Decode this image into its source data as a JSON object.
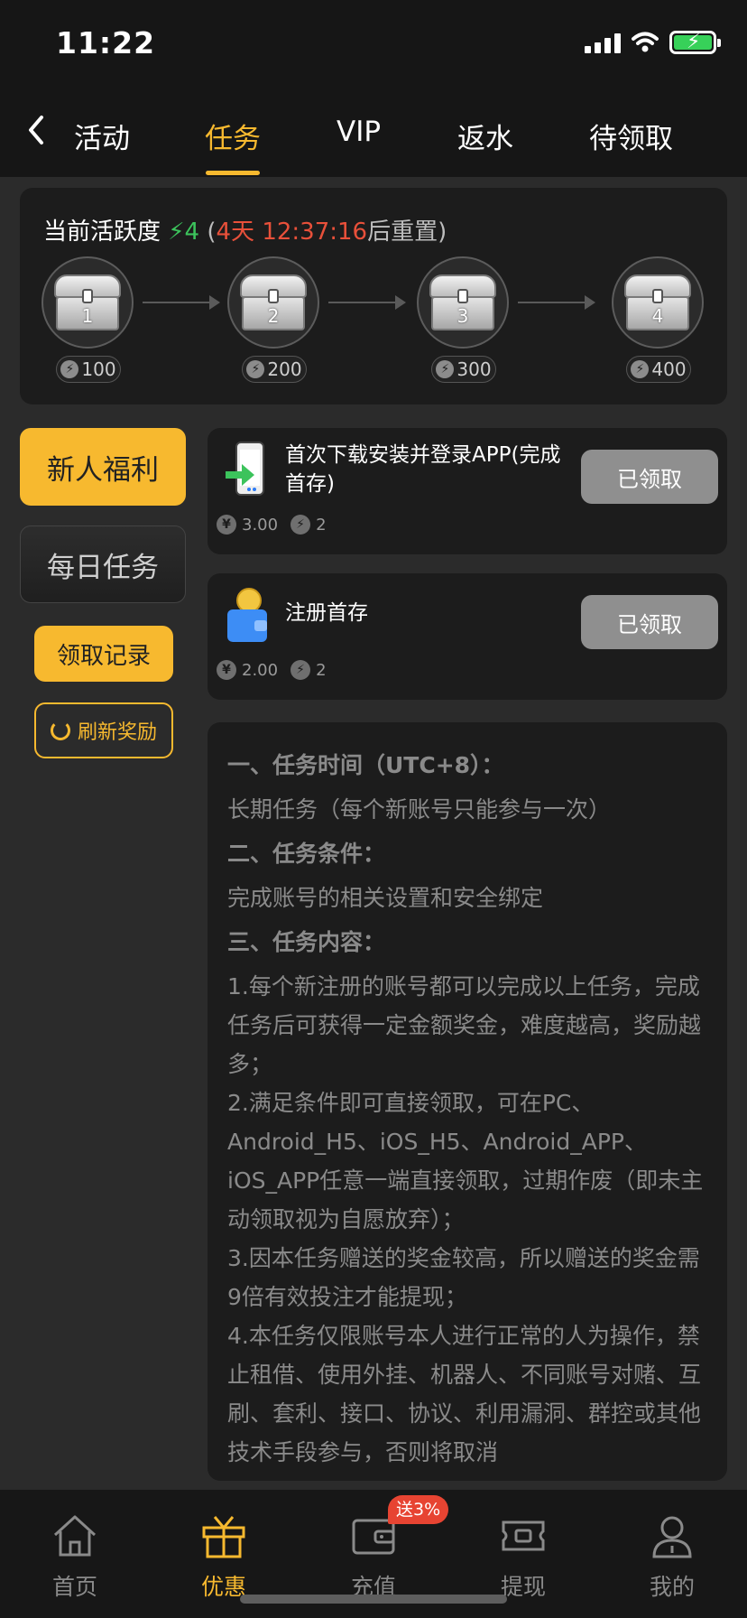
{
  "status_bar": {
    "time": "11:22"
  },
  "nav": {
    "tabs": [
      {
        "label": "活动",
        "active": false
      },
      {
        "label": "任务",
        "active": true
      },
      {
        "label": "VIP",
        "active": false
      },
      {
        "label": "返水",
        "active": false
      },
      {
        "label": "待领取",
        "active": false
      }
    ]
  },
  "activity": {
    "label": "当前活跃度",
    "value": "4",
    "reset_open": "(",
    "reset_days": "4天",
    "reset_time": "12:37:16",
    "reset_suffix": "后重置)",
    "chests": [
      {
        "num": "1",
        "points": "100"
      },
      {
        "num": "2",
        "points": "200"
      },
      {
        "num": "3",
        "points": "300"
      },
      {
        "num": "4",
        "points": "400"
      }
    ]
  },
  "sidebar": {
    "new_user": "新人福利",
    "daily": "每日任务",
    "record": "领取记录",
    "refresh": "刷新奖励"
  },
  "tasks": [
    {
      "title": "首次下载安装并登录APP(完成首存)",
      "button": "已领取",
      "reward": "3.00",
      "activity": "2",
      "icon": "phone-download-icon"
    },
    {
      "title": "注册首存",
      "button": "已领取",
      "reward": "2.00",
      "activity": "2",
      "icon": "wallet-coin-icon"
    }
  ],
  "rules": {
    "h1": "一、任务时间（UTC+8）：",
    "p1": "长期任务（每个新账号只能参与一次）",
    "h2": "二、任务条件：",
    "p2": "完成账号的相关设置和安全绑定",
    "h3": "三、任务内容：",
    "p3": "1.每个新注册的账号都可以完成以上任务，完成任务后可获得一定金额奖金，难度越高，奖励越多；",
    "p4": "2.满足条件即可直接领取，可在PC、Android_H5、iOS_H5、Android_APP、iOS_APP任意一端直接领取，过期作废（即未主动领取视为自愿放弃）；",
    "p5": "3.因本任务赠送的奖金较高，所以赠送的奖金需9倍有效投注才能提现；",
    "p6": "4.本任务仅限账号本人进行正常的人为操作，禁止租借、使用外挂、机器人、不同账号对赌、互刷、套利、接口、协议、利用漏洞、群控或其他技术手段参与，否则将取消"
  },
  "tabbar": {
    "items": [
      {
        "label": "首页",
        "icon": "home-icon",
        "active": false
      },
      {
        "label": "优惠",
        "icon": "gift-icon",
        "active": true
      },
      {
        "label": "充值",
        "icon": "wallet-icon",
        "active": false
      },
      {
        "label": "提现",
        "icon": "ticket-icon",
        "active": false
      },
      {
        "label": "我的",
        "icon": "profile-icon",
        "active": false
      }
    ],
    "deposit_badge": "送3%"
  },
  "colors": {
    "accent": "#f7b92f",
    "green": "#3cc35c",
    "red": "#e8503a",
    "panel": "#1c1c1c",
    "bg": "#2b2b2b"
  }
}
